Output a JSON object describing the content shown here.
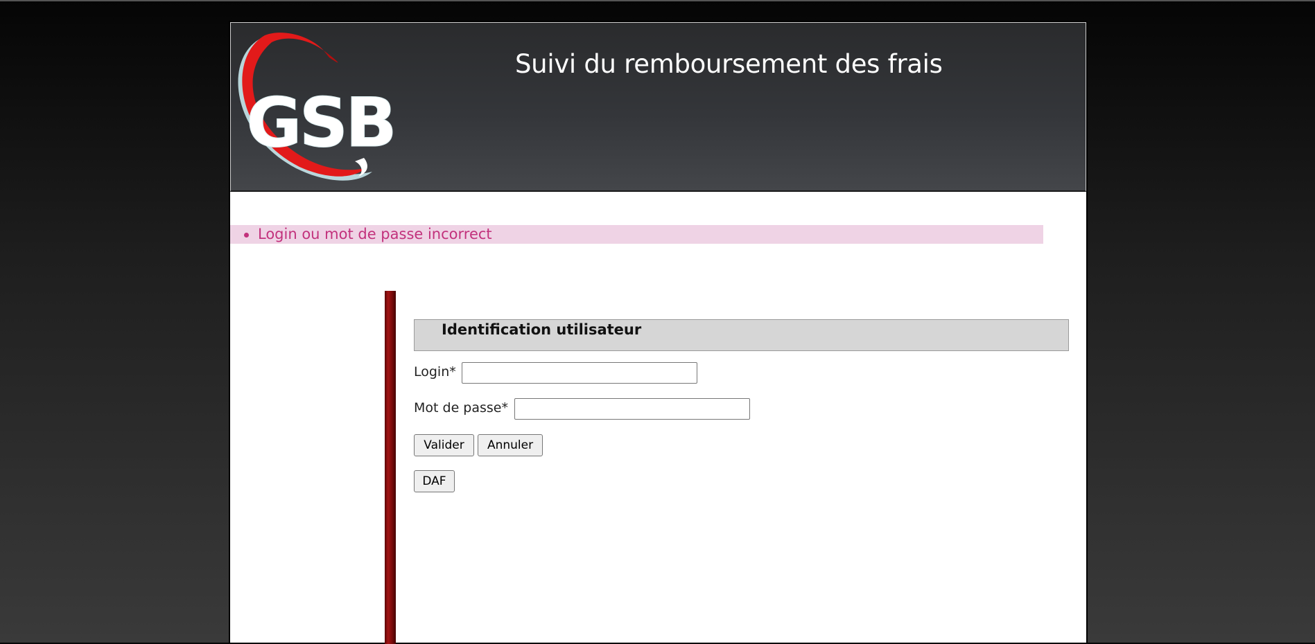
{
  "header": {
    "logo_text": "GSB",
    "title": "Suivi du remboursement des frais"
  },
  "errors": [
    "Login ou mot de passe incorrect"
  ],
  "login_form": {
    "section_title": "Identification utilisateur",
    "login_label": "Login*",
    "login_value": "",
    "password_label": "Mot de passe*",
    "password_value": "",
    "submit_label": "Valider",
    "reset_label": "Annuler",
    "daf_label": "DAF"
  },
  "colors": {
    "header_bg": "#34363a",
    "error_bg": "#efd3e5",
    "error_text": "#c2317c",
    "accent_bar": "#8b0d0d",
    "section_header_bg": "#d6d6d6"
  }
}
